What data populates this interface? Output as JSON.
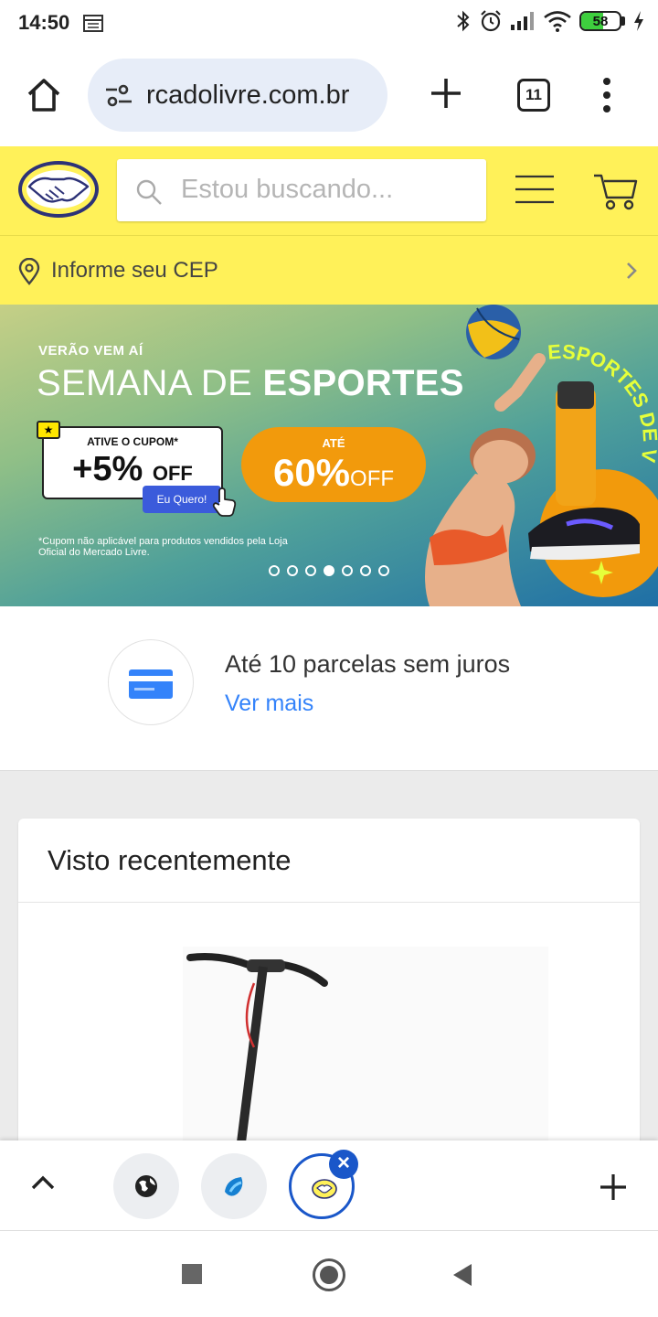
{
  "status_bar": {
    "time": "14:50",
    "battery_percent": "58",
    "battery_level": 0.58,
    "icons": [
      "calendar-icon",
      "bluetooth-icon",
      "alarm-icon",
      "signal-icon",
      "wifi-icon",
      "battery-icon",
      "charging-icon"
    ]
  },
  "browser": {
    "url": "rcadolivre.com.br",
    "tab_count": "11",
    "icons": [
      "home-icon",
      "site-settings-icon",
      "new-tab-plus-icon",
      "tab-switcher-icon",
      "overflow-menu-icon"
    ]
  },
  "header": {
    "search_placeholder": "Estou buscando...",
    "cep_label": "Informe seu CEP",
    "colors": {
      "brand_yellow": "#fff159"
    }
  },
  "banner": {
    "eyebrow": "VERÃO VEM AÍ",
    "title_regular": "SEMANA DE ",
    "title_bold": "ESPORTES",
    "coupon_label": "ATIVE O CUPOM*",
    "coupon_value": "+5%",
    "coupon_off": "OFF",
    "coupon_button": "Eu Quero!",
    "discount_label": "ATÉ",
    "discount_value": "60%",
    "discount_off": "OFF",
    "footnote": "*Cupom não aplicável para produtos vendidos pela Loja Oficial do Mercado Livre.",
    "carousel_total": 7,
    "carousel_active": 4,
    "badge_text": "ESPORTES DE V"
  },
  "installments": {
    "title": "Até 10 parcelas sem juros",
    "link": "Ver mais"
  },
  "recent": {
    "title": "Visto recentemente"
  },
  "tab_strip": {
    "close_symbol": "×"
  },
  "accent": {
    "link_blue": "#3483fa",
    "tab_blue": "#1a57c9",
    "orange": "#f29a0c"
  }
}
